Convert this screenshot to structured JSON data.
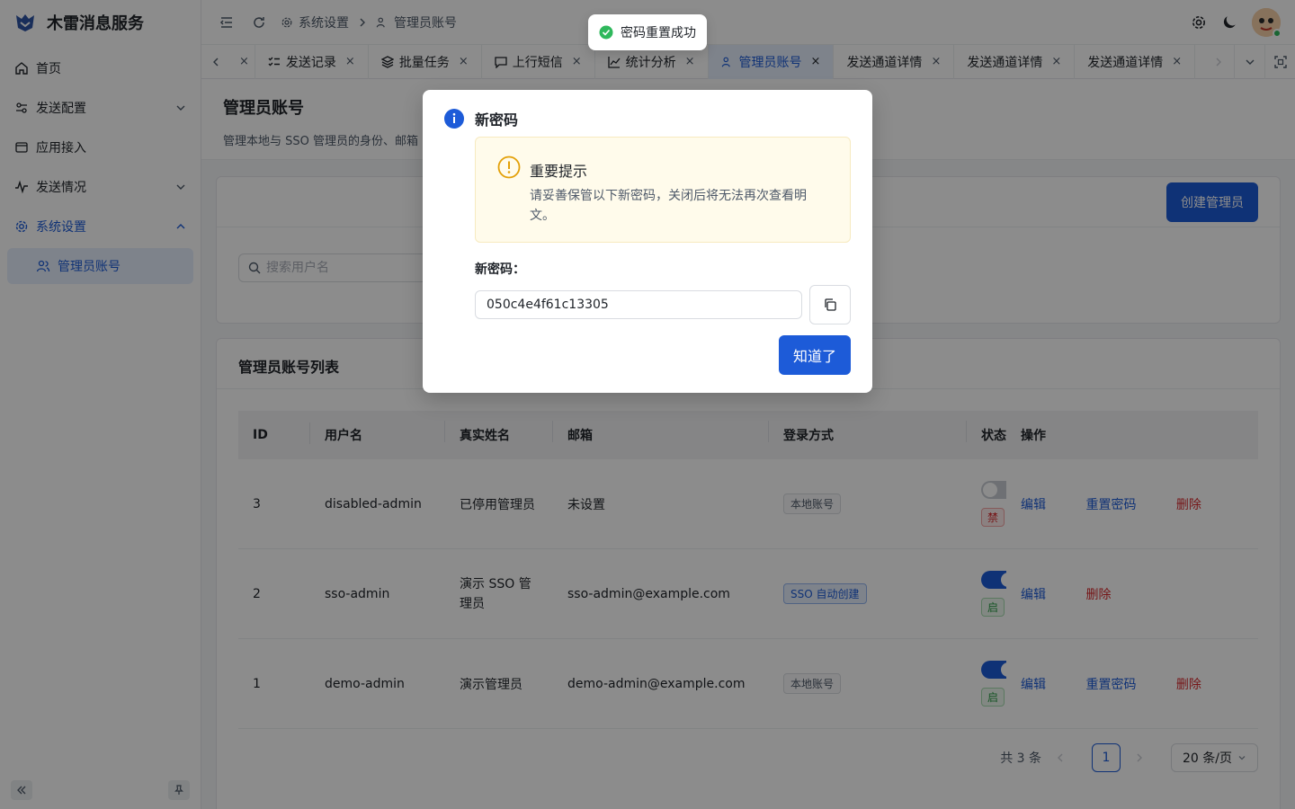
{
  "brand": {
    "title": "木雷消息服务"
  },
  "sidebar": {
    "items": [
      {
        "label": "首页"
      },
      {
        "label": "发送配置"
      },
      {
        "label": "应用接入"
      },
      {
        "label": "发送情况"
      },
      {
        "label": "系统设置"
      },
      {
        "label": "管理员账号"
      }
    ]
  },
  "header": {
    "crumbs": [
      "系统设置",
      "管理员账号"
    ]
  },
  "tabs": [
    {
      "label": "发送记录"
    },
    {
      "label": "批量任务"
    },
    {
      "label": "上行短信"
    },
    {
      "label": "统计分析"
    },
    {
      "label": "管理员账号"
    },
    {
      "label": "发送通道详情"
    },
    {
      "label": "发送通道详情"
    },
    {
      "label": "发送通道详情"
    }
  ],
  "tab_close": "×",
  "page": {
    "title": "管理员账号",
    "desc": "管理本地与 SSO 管理员的身份、邮箱",
    "create_label": "创建管理员",
    "search_placeholder": "搜索用户名",
    "list_title": "管理员账号列表"
  },
  "table": {
    "columns": [
      "ID",
      "用户名",
      "真实姓名",
      "邮箱",
      "登录方式",
      "状态",
      "操作"
    ],
    "rows": [
      {
        "id": "3",
        "user": "disabled-admin",
        "name": "已停用管理员",
        "mail": "未设置",
        "login": "本地账号",
        "status": "禁",
        "ops": [
          "编辑",
          "重置密码",
          "删除"
        ]
      },
      {
        "id": "2",
        "user": "sso-admin",
        "name": "演示 SSO 管理员",
        "mail": "sso-admin@example.com",
        "login": "SSO 自动创建",
        "status": "启",
        "ops": [
          "编辑",
          "删除"
        ]
      },
      {
        "id": "1",
        "user": "demo-admin",
        "name": "演示管理员",
        "mail": "demo-admin@example.com",
        "login": "本地账号",
        "status": "启",
        "ops": [
          "编辑",
          "重置密码",
          "删除"
        ]
      }
    ]
  },
  "pager": {
    "total": "共 3 条",
    "page": "1",
    "size": "20 条/页"
  },
  "toast": {
    "text": "密码重置成功"
  },
  "modal": {
    "title": "新密码",
    "alert_title": "重要提示",
    "alert_desc": "请妥善保管以下新密码，关闭后将无法再次查看明文。",
    "pw_label": "新密码：",
    "pw_value": "050c4e4f61c13305",
    "ok_label": "知道了"
  },
  "colors": {
    "primary": "#1d5bd8",
    "danger": "#d7282c",
    "success": "#2fb85c",
    "warning": "#e3a008"
  }
}
